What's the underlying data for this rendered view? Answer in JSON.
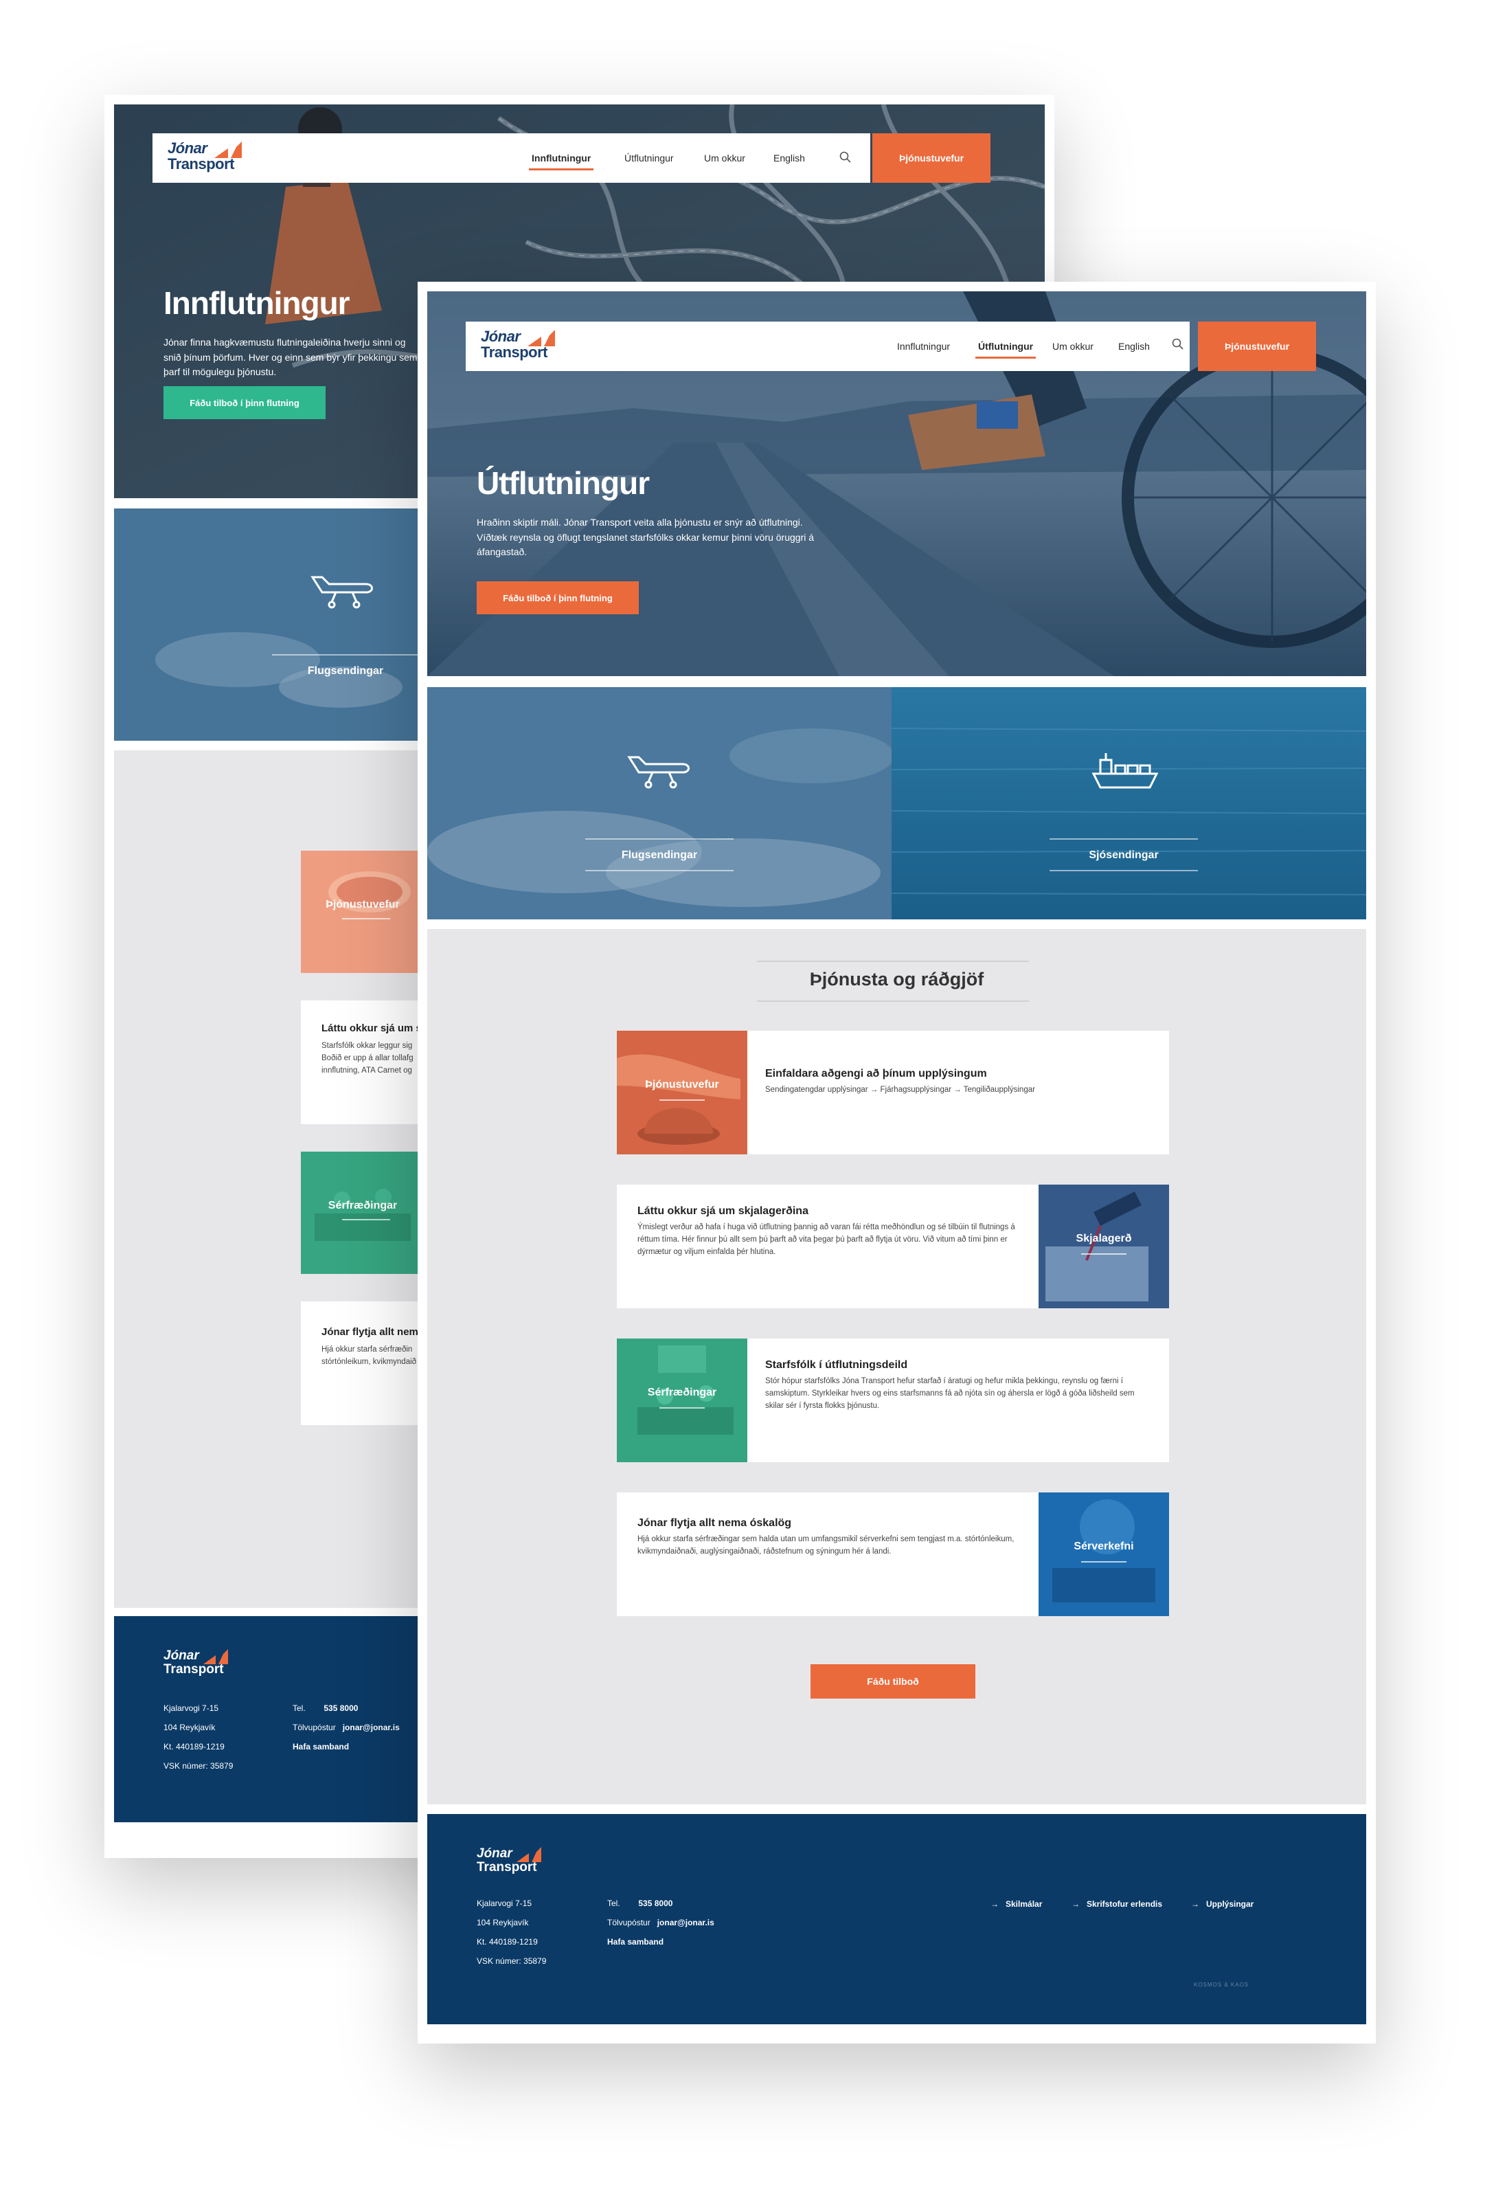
{
  "brand": {
    "logo_line1": "Jónar",
    "logo_line2": "Transport",
    "accent": "#eb6a3c",
    "navy": "#0b3a66",
    "green": "#2fb88e"
  },
  "nav": {
    "items": [
      "Innflutningur",
      "Útflutningur",
      "Um okkur",
      "English"
    ],
    "cta": "Þjónustuvefur",
    "search_icon": "search-icon"
  },
  "back": {
    "hero": {
      "title": "Innflutningur",
      "text": "Jónar finna hagkvæmustu flutningaleiðina hverju sinni og snið þínum þörfum. Hver og einn sem býr yfir þekkingu sem þarf til mögulegu þjónustu.",
      "button": "Fáðu tilboð í þinn flutning"
    },
    "tiles": [
      "Flugsendingar"
    ],
    "cards": [
      {
        "image_label": "Þjónustuvefur"
      },
      {
        "title": "Láttu okkur sjá um s",
        "text": "Starfsfólk okkar leggur sig Boðið er upp á allar tollafg innflutning, ATA Carnet og"
      },
      {
        "image_label": "Sérfræðingar"
      },
      {
        "title": "Jónar flytja allt nema",
        "text": "Hjá okkur starfa sérfræðin stórtónleikum, kvikmyndaið"
      }
    ],
    "footer": {
      "address1": "Kjalarvogi 7-15",
      "address2": "104 Reykjavík",
      "kt": "Kt. 440189-1219",
      "vsk": "VSK númer: 35879",
      "tel_label": "Tel.",
      "tel": "535 8000",
      "email_label": "Tölvupóstur",
      "email": "jonar@jonar.is",
      "contact": "Hafa samband"
    }
  },
  "front": {
    "hero": {
      "title": "Útflutningur",
      "text": "Hraðinn skiptir máli. Jónar Transport veita alla þjónustu er snýr að útflutningi. Víðtæk reynsla og öflugt tengslanet starfsfólks okkar kemur þinni vöru öruggri á áfangastað.",
      "button": "Fáðu tilboð í þinn flutning"
    },
    "tiles": [
      "Flugsendingar",
      "Sjósendingar"
    ],
    "section_title": "Þjónusta og ráðgjöf",
    "cards": [
      {
        "image_label": "Þjónustuvefur",
        "title": "Einfaldara aðgengi að þínum upplýsingum",
        "text": "Sendingatengdar upplýsingar → Fjárhagsupplýsingar → Tengiliðaupplýsingar"
      },
      {
        "image_label": "Skjalagerð",
        "title": "Láttu okkur sjá um skjalagerðina",
        "text": "Ýmislegt verður að hafa í huga við útflutning þannig að varan fái rétta meðhöndlun og sé tilbúin til flutnings á réttum tíma. Hér finnur þú allt sem þú þarft að vita þegar þú þarft að flytja út vöru. Við vitum að tími þinn er dýrmætur og viljum einfalda þér hlutina."
      },
      {
        "image_label": "Sérfræðingar",
        "title": "Starfsfólk í útflutningsdeild",
        "text": "Stór hópur starfsfólks Jóna Transport hefur starfað í áratugi og hefur mikla þekkingu, reynslu og færni í samskiptum. Styrkleikar hvers og eins starfsmanns fá að njóta sín og áhersla er lögð á góða liðsheild sem skilar sér í fyrsta flokks þjónustu."
      },
      {
        "image_label": "Sérverkefni",
        "title": "Jónar flytja allt nema óskalög",
        "text": "Hjá okkur starfa sérfræðingar sem halda utan um umfangsmikil sérverkefni sem tengjast m.a. stórtónleikum, kvikmyndaiðnaði, auglýsingaiðnaði, ráðstefnum og sýningum hér á landi."
      }
    ],
    "cta": "Fáðu tilboð",
    "footer": {
      "address1": "Kjalarvogi 7-15",
      "address2": "104 Reykjavík",
      "kt": "Kt. 440189-1219",
      "vsk": "VSK númer: 35879",
      "tel_label": "Tel.",
      "tel": "535 8000",
      "email_label": "Tölvupóstur",
      "email": "jonar@jonar.is",
      "contact": "Hafa samband",
      "links": [
        "Skilmálar",
        "Skrifstofur erlendis",
        "Upplýsingar"
      ],
      "credit": "KOSMOS & KAOS"
    }
  }
}
